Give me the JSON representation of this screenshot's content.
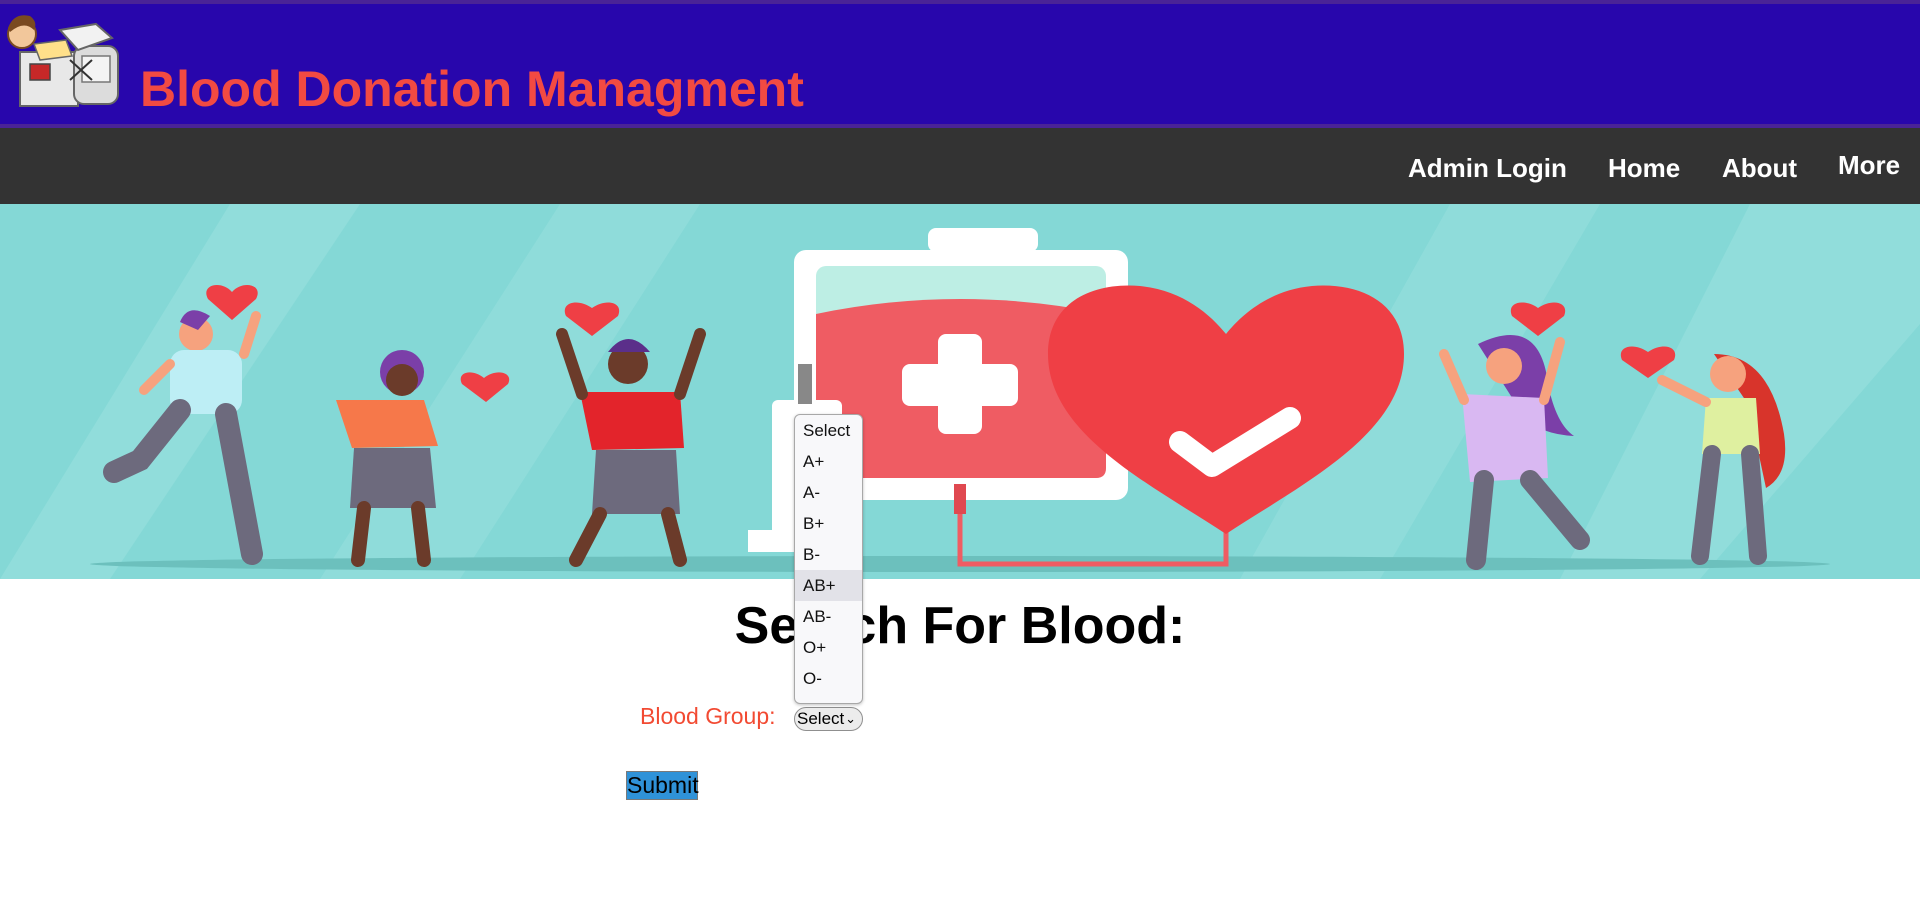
{
  "header": {
    "title": "Blood Donation Managment"
  },
  "nav": {
    "items": [
      {
        "label": "Admin Login"
      },
      {
        "label": "Home"
      },
      {
        "label": "About"
      },
      {
        "label": "More"
      }
    ]
  },
  "search": {
    "heading": "Search For Blood:",
    "blood_group_label": "Blood Group:",
    "selected_value": "Select",
    "options": [
      "Select",
      "A+",
      "A-",
      "B+",
      "B-",
      "AB+",
      "AB-",
      "O+",
      "O-"
    ],
    "highlighted_option": "AB+",
    "submit_label": "Submit"
  },
  "colors": {
    "header_bg": "#2806ac",
    "title_color": "#f24a42",
    "nav_bg": "#333333",
    "banner_bg": "#84d8d6",
    "label_color": "#f24a32",
    "submit_bg": "#2f92d8"
  }
}
